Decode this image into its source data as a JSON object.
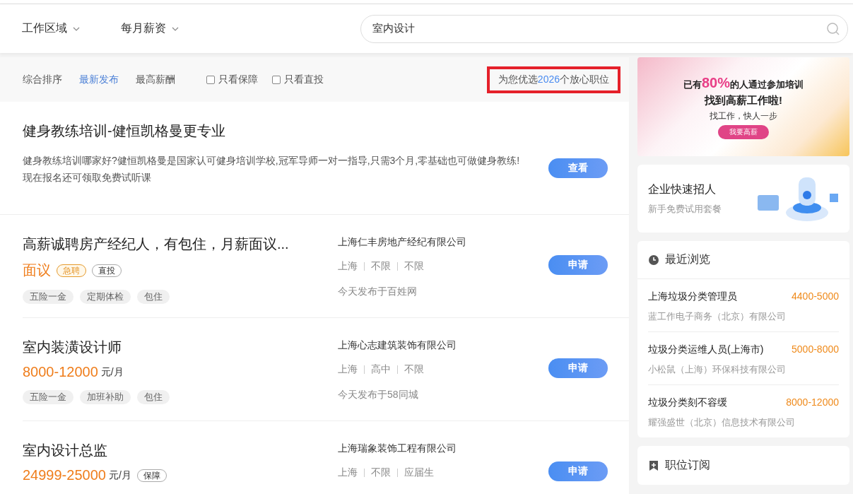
{
  "filters": [
    {
      "label": "工作区域"
    },
    {
      "label": "每月薪资"
    }
  ],
  "search": {
    "value": "室内设计"
  },
  "sort_tabs": [
    {
      "label": "综合排序",
      "selected": false
    },
    {
      "label": "最新发布",
      "selected": true
    },
    {
      "label": "最高薪酬",
      "selected": false
    }
  ],
  "checkboxes": [
    {
      "label": "只看保障",
      "checked": false
    },
    {
      "label": "只看直投",
      "checked": false
    }
  ],
  "result_count": {
    "prefix": "为您优选",
    "count": "2026",
    "suffix": "个放心职位"
  },
  "listings": [
    {
      "kind": "ad",
      "title": "健身教练培训-健恒凯格曼更专业",
      "description": "健身教练培训哪家好?健恒凯格曼是国家认可健身培训学校,冠军导师一对一指导,只需3个月,零基础也可做健身教练!现在报名还可领取免费试听课",
      "button": "查看"
    },
    {
      "kind": "job",
      "title": "高薪诚聘房产经纪人，有包住，月薪面议...",
      "salary": "面议",
      "badges": [
        {
          "label": "急聘",
          "kind": "urgent"
        },
        {
          "label": "直投",
          "kind": "plain"
        }
      ],
      "tags": [
        "五险一金",
        "定期体检",
        "包住"
      ],
      "company": "上海仁丰房地产经纪有限公司",
      "meta": [
        "上海",
        "不限",
        "不限"
      ],
      "source": "今天发布于百姓网",
      "button": "申请"
    },
    {
      "kind": "job",
      "title": "室内装潢设计师",
      "salary": "8000-12000",
      "unit": "元/月",
      "tags": [
        "五险一金",
        "加班补助",
        "包住"
      ],
      "company": "上海心志建筑装饰有限公司",
      "meta": [
        "上海",
        "高中",
        "不限"
      ],
      "source": "今天发布于58同城",
      "button": "申请"
    },
    {
      "kind": "job",
      "title": "室内设计总监",
      "salary": "24999-25000",
      "unit": "元/月",
      "badges": [
        {
          "label": "保障",
          "kind": "plain"
        }
      ],
      "company": "上海瑞象装饰工程有限公司",
      "meta": [
        "上海",
        "不限",
        "应届生"
      ],
      "button": "申请"
    }
  ],
  "banner": {
    "headline_before": "已有",
    "headline_highlight": "80%",
    "headline_after": "的人通过参加培训",
    "headline_line2": "找到高薪工作啦!",
    "subline": "找工作，快人一步",
    "button": "我要高薪"
  },
  "promo": {
    "title": "企业快速招人",
    "subtitle": "新手免费试用套餐"
  },
  "recent": {
    "title": "最近浏览",
    "items": [
      {
        "title": "上海垃圾分类管理员",
        "salary": "4400-5000",
        "company": "蓝工作电子商务（北京）有限公司"
      },
      {
        "title": "垃圾分类运维人员(上海市)",
        "salary": "5000-8000",
        "company": "小松鼠（上海）环保科技有限公司"
      },
      {
        "title": "垃圾分类刻不容缓",
        "salary": "8000-12000",
        "company": "耀强盛世（北京）信息技术有限公司"
      }
    ]
  },
  "subscribe": {
    "title": "职位订阅"
  }
}
